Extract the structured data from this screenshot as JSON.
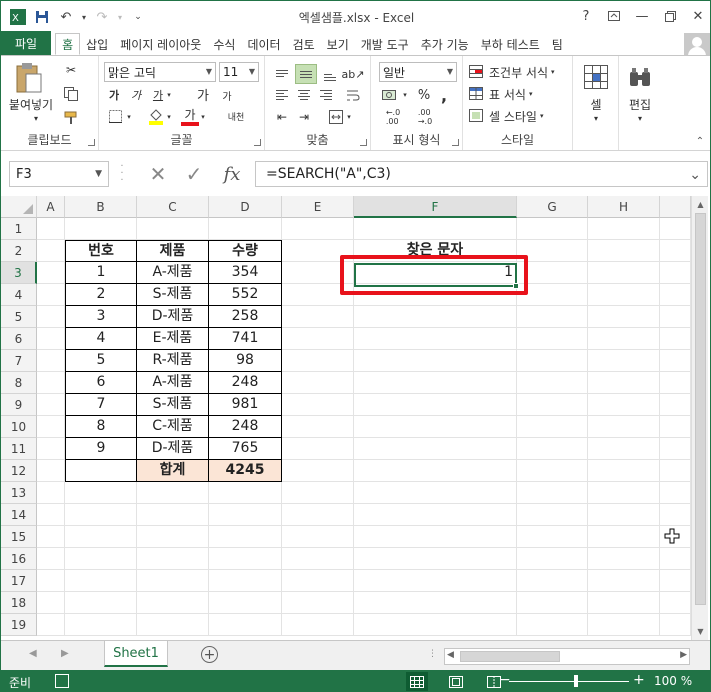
{
  "window": {
    "title": "엑셀샘플.xlsx - Excel",
    "help": "?"
  },
  "ribbon_tabs": [
    "파일",
    "홈",
    "삽입",
    "페이지 레이아웃",
    "수식",
    "데이터",
    "검토",
    "보기",
    "개발 도구",
    "추가 기능",
    "부하 테스트",
    "팀"
  ],
  "ribbon": {
    "clipboard": {
      "paste_label": "붙여넣기",
      "group_label": "클립보드"
    },
    "font": {
      "font_name": "맑은 고딕",
      "font_size": "11",
      "group_label": "글꼴",
      "bold": "가",
      "italic": "가",
      "underline": "가",
      "grow": "가",
      "shrink": "가",
      "font_color": "가",
      "phonetic": "내천"
    },
    "alignment": {
      "group_label": "맞춤"
    },
    "number": {
      "format": "일반",
      "group_label": "표시 형식",
      "percent": "%",
      "comma": ","
    },
    "styles": {
      "conditional": "조건부 서식",
      "table": "표 서식",
      "cell": "셀 스타일",
      "group_label": "스타일"
    },
    "cells": {
      "label": "셀"
    },
    "editing": {
      "label": "편집"
    }
  },
  "formula_bar": {
    "name_box": "F3",
    "formula": "=SEARCH(\"A\",C3)",
    "fx": "fx"
  },
  "columns": [
    "A",
    "B",
    "C",
    "D",
    "E",
    "F",
    "G",
    "H"
  ],
  "rows": [
    "1",
    "2",
    "3",
    "4",
    "5",
    "6",
    "7",
    "8",
    "9",
    "10",
    "11",
    "12",
    "13",
    "14",
    "15",
    "16",
    "17",
    "18",
    "19"
  ],
  "table": {
    "headers": [
      "번호",
      "제품",
      "수량"
    ],
    "rows": [
      [
        "1",
        "A-제품",
        "354"
      ],
      [
        "2",
        "S-제품",
        "552"
      ],
      [
        "3",
        "D-제품",
        "258"
      ],
      [
        "4",
        "E-제품",
        "741"
      ],
      [
        "5",
        "R-제품",
        "98"
      ],
      [
        "6",
        "A-제품",
        "248"
      ],
      [
        "7",
        "S-제품",
        "981"
      ],
      [
        "8",
        "C-제품",
        "248"
      ],
      [
        "9",
        "D-제품",
        "765"
      ]
    ],
    "total_label": "합계",
    "total_value": "4245"
  },
  "result": {
    "header": "찾은 문자",
    "value": "1"
  },
  "sheets": {
    "active": "Sheet1"
  },
  "status": {
    "ready": "준비",
    "zoom": "100 %",
    "zoom_percent": 100
  },
  "colors": {
    "accent": "#217346",
    "highlight": "#e8121b",
    "total_fill": "#fbe5d6"
  }
}
